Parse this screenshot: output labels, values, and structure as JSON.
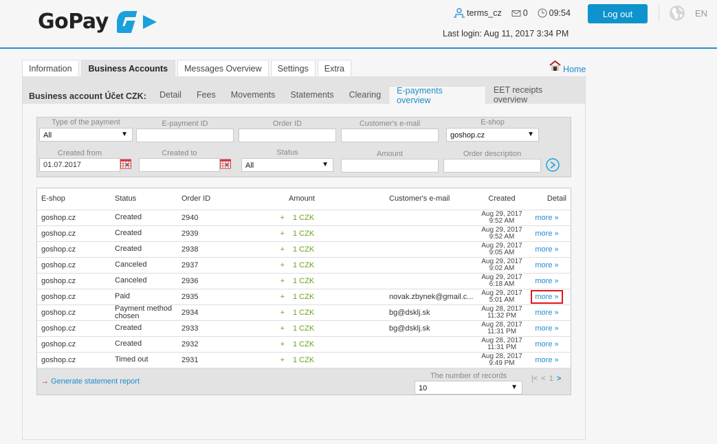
{
  "header": {
    "brand": "GoPay",
    "username": "terms_cz",
    "messages_count": "0",
    "time": "09:54",
    "logout_label": "Log out",
    "language": "EN",
    "last_login": "Last login: Aug 11, 2017 3:34 PM",
    "brand_color": "#0f93cc"
  },
  "main_tabs": [
    {
      "label": "Information"
    },
    {
      "label": "Business Accounts",
      "active": true
    },
    {
      "label": "Messages Overview"
    },
    {
      "label": "Settings"
    },
    {
      "label": "Extra"
    }
  ],
  "home_label": "Home",
  "subbar": {
    "title": "Business account Účet CZK:",
    "tabs": [
      {
        "label": "Detail"
      },
      {
        "label": "Fees"
      },
      {
        "label": "Movements"
      },
      {
        "label": "Statements"
      },
      {
        "label": "Clearing"
      },
      {
        "label": "E-payments overview",
        "active": true
      },
      {
        "label": "EET receipts overview"
      }
    ]
  },
  "filter": {
    "type_label": "Type of the payment",
    "type_value": "All",
    "epayment_id_label": "E-payment ID",
    "epayment_id_value": "",
    "order_id_label": "Order ID",
    "order_id_value": "",
    "email_label": "Customer's e-mail",
    "email_value": "",
    "eshop_label": "E-shop",
    "eshop_value": "goshop.cz",
    "created_from_label": "Created from",
    "created_from_value": "01.07.2017",
    "created_to_label": "Created to",
    "created_to_value": "",
    "status_label": "Status",
    "status_value": "All",
    "amount_label": "Amount",
    "amount_value": "",
    "description_label": "Order description",
    "description_value": ""
  },
  "table": {
    "headers": {
      "eshop": "E-shop",
      "status": "Status",
      "order_id": "Order ID",
      "amount": "Amount",
      "email": "Customer's e-mail",
      "created": "Created",
      "detail": "Detail"
    },
    "rows": [
      {
        "eshop": "goshop.cz",
        "status": "Created",
        "order_id": "2940",
        "sign": "+",
        "amount": "1 CZK",
        "email": "",
        "date": "Aug 29, 2017",
        "time": "9:52 AM",
        "detail": "more »"
      },
      {
        "eshop": "goshop.cz",
        "status": "Created",
        "order_id": "2939",
        "sign": "+",
        "amount": "1 CZK",
        "email": "",
        "date": "Aug 29, 2017",
        "time": "9:52 AM",
        "detail": "more »"
      },
      {
        "eshop": "goshop.cz",
        "status": "Created",
        "order_id": "2938",
        "sign": "+",
        "amount": "1 CZK",
        "email": "",
        "date": "Aug 29, 2017",
        "time": "9:05 AM",
        "detail": "more »"
      },
      {
        "eshop": "goshop.cz",
        "status": "Canceled",
        "order_id": "2937",
        "sign": "+",
        "amount": "1 CZK",
        "email": "",
        "date": "Aug 29, 2017",
        "time": "9:02 AM",
        "detail": "more »"
      },
      {
        "eshop": "goshop.cz",
        "status": "Canceled",
        "order_id": "2936",
        "sign": "+",
        "amount": "1 CZK",
        "email": "",
        "date": "Aug 29, 2017",
        "time": "6:18 AM",
        "detail": "more »"
      },
      {
        "eshop": "goshop.cz",
        "status": "Paid",
        "order_id": "2935",
        "sign": "+",
        "amount": "1 CZK",
        "email": "novak.zbynek@gmail.c...",
        "date": "Aug 29, 2017",
        "time": "5:01 AM",
        "detail": "more »",
        "highlighted": true
      },
      {
        "eshop": "goshop.cz",
        "status": "Payment method chosen",
        "order_id": "2934",
        "sign": "+",
        "amount": "1 CZK",
        "email": "bg@dsklj.sk",
        "date": "Aug 28, 2017",
        "time": "11:32 PM",
        "detail": "more »"
      },
      {
        "eshop": "goshop.cz",
        "status": "Created",
        "order_id": "2933",
        "sign": "+",
        "amount": "1 CZK",
        "email": "bg@dsklj.sk",
        "date": "Aug 28, 2017",
        "time": "11:31 PM",
        "detail": "more »"
      },
      {
        "eshop": "goshop.cz",
        "status": "Created",
        "order_id": "2932",
        "sign": "+",
        "amount": "1 CZK",
        "email": "",
        "date": "Aug 28, 2017",
        "time": "11:31 PM",
        "detail": "more »"
      },
      {
        "eshop": "goshop.cz",
        "status": "Timed out",
        "order_id": "2931",
        "sign": "+",
        "amount": "1 CZK",
        "email": "",
        "date": "Aug 28, 2017",
        "time": "9:49 PM",
        "detail": "more »"
      }
    ]
  },
  "footer": {
    "generate_report": "Generate statement report",
    "records_label": "The number of records",
    "records_value": "10",
    "current_page": "1"
  }
}
